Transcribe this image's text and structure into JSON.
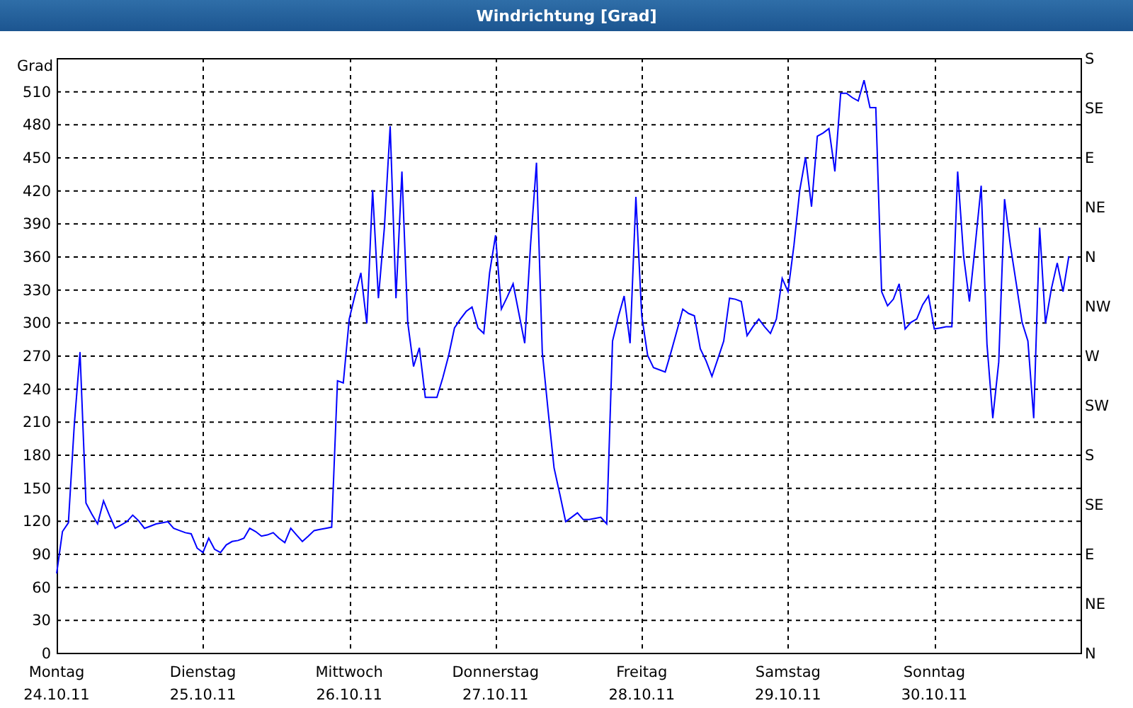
{
  "window": {
    "title": "Windrichtung [Grad]"
  },
  "chart": {
    "right_axis_labels": [
      "S",
      "SE",
      "E",
      "NE",
      "N",
      "NW",
      "W",
      "SW",
      "S",
      "SE",
      "E",
      "NE",
      "N"
    ],
    "x_axis_dates": [
      "24.10.11",
      "25.10.11",
      "26.10.11",
      "27.10.11",
      "28.10.11",
      "29.10.11",
      "30.10.11"
    ],
    "chart_data": {
      "type": "line",
      "ylabel": "Grad",
      "grid": true,
      "ylim": [
        0,
        540
      ],
      "yticks": [
        {
          "value": 0,
          "label": "0"
        },
        {
          "value": 30,
          "label": "30"
        },
        {
          "value": 60,
          "label": "60"
        },
        {
          "value": 90,
          "label": "90"
        },
        {
          "value": 120,
          "label": "120"
        },
        {
          "value": 150,
          "label": "150"
        },
        {
          "value": 180,
          "label": "180"
        },
        {
          "value": 210,
          "label": "210"
        },
        {
          "value": 240,
          "label": "240"
        },
        {
          "value": 270,
          "label": "270"
        },
        {
          "value": 300,
          "label": "300"
        },
        {
          "value": 330,
          "label": "330"
        },
        {
          "value": 360,
          "label": "360"
        },
        {
          "value": 390,
          "label": "390"
        },
        {
          "value": 420,
          "label": "420"
        },
        {
          "value": 450,
          "label": "450"
        },
        {
          "value": 480,
          "label": "480"
        },
        {
          "value": 510,
          "label": "510"
        }
      ],
      "categories": [
        "Montag",
        null,
        null,
        null,
        null,
        null,
        null,
        null,
        null,
        null,
        null,
        null,
        null,
        null,
        null,
        null,
        null,
        null,
        null,
        null,
        null,
        null,
        null,
        null,
        null,
        "Dienstag",
        null,
        null,
        null,
        null,
        null,
        null,
        null,
        null,
        null,
        null,
        null,
        null,
        null,
        null,
        null,
        null,
        null,
        null,
        null,
        null,
        null,
        null,
        null,
        null,
        "Mittwoch",
        null,
        null,
        null,
        null,
        null,
        null,
        null,
        null,
        null,
        null,
        null,
        null,
        null,
        null,
        null,
        null,
        null,
        null,
        null,
        null,
        null,
        null,
        null,
        null,
        "Donnerstag",
        null,
        null,
        null,
        null,
        null,
        null,
        null,
        null,
        null,
        null,
        null,
        null,
        null,
        null,
        null,
        null,
        null,
        null,
        null,
        null,
        null,
        null,
        null,
        null,
        "Freitag",
        null,
        null,
        null,
        null,
        null,
        null,
        null,
        null,
        null,
        null,
        null,
        null,
        null,
        null,
        null,
        null,
        null,
        null,
        null,
        null,
        null,
        null,
        null,
        null,
        "Samstag",
        null,
        null,
        null,
        null,
        null,
        null,
        null,
        null,
        null,
        null,
        null,
        null,
        null,
        null,
        null,
        null,
        null,
        null,
        null,
        null,
        null,
        null,
        null,
        null,
        "Sonntag",
        null,
        null,
        null,
        null,
        null,
        null,
        null,
        null,
        null,
        null,
        null,
        null,
        null,
        null,
        null,
        null,
        null,
        null,
        null,
        null,
        null,
        null,
        null,
        null
      ],
      "series": [
        {
          "color": "#0000ff",
          "values": [
            72,
            110,
            118,
            206,
            273,
            136,
            126,
            117,
            138,
            125,
            113,
            116,
            119,
            125,
            120,
            113,
            115,
            117,
            118,
            119,
            113,
            111,
            109,
            108,
            95,
            91,
            104,
            94,
            91,
            98,
            101,
            102,
            104,
            113,
            110,
            106,
            107,
            109,
            104,
            100,
            113,
            107,
            101,
            106,
            111,
            112,
            113,
            114,
            247,
            245,
            303,
            325,
            345,
            299,
            420,
            322,
            386,
            478,
            322,
            437,
            300,
            260,
            277,
            232,
            232,
            232,
            250,
            270,
            295,
            303,
            310,
            314,
            295,
            290,
            345,
            379,
            312,
            323,
            335,
            308,
            281,
            370,
            445,
            273,
            220,
            168,
            144,
            119,
            123,
            127,
            121,
            121,
            122,
            123,
            117,
            283,
            305,
            324,
            281,
            414,
            306,
            270,
            259,
            257,
            255,
            273,
            292,
            312,
            308,
            306,
            276,
            265,
            251,
            267,
            283,
            322,
            321,
            319,
            288,
            296,
            303,
            296,
            290,
            303,
            340,
            328,
            370,
            420,
            450,
            405,
            469,
            472,
            476,
            437,
            508,
            508,
            504,
            501,
            520,
            495,
            495,
            328,
            315,
            321,
            335,
            294,
            300,
            303,
            316,
            324,
            294,
            295,
            296,
            296,
            437,
            360,
            319,
            370,
            424,
            280,
            213,
            264,
            412,
            370,
            335,
            300,
            283,
            213,
            386,
            299,
            330,
            354,
            328,
            360,
            null
          ]
        }
      ]
    }
  }
}
